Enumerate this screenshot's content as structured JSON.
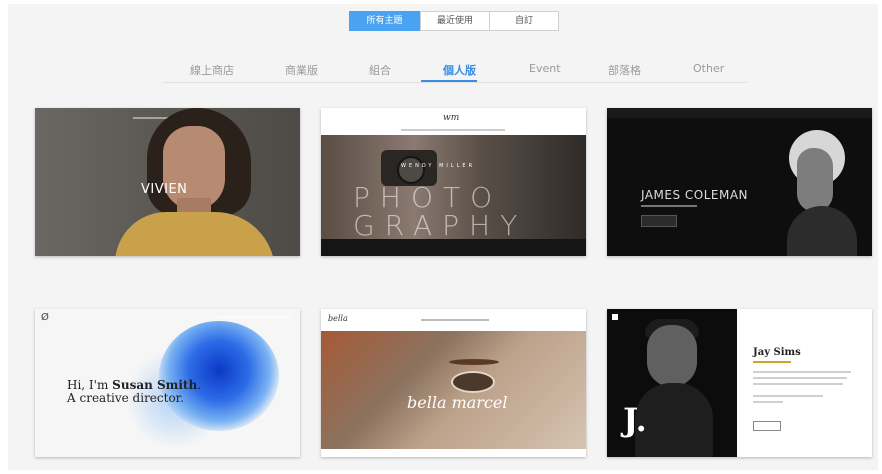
{
  "top_tabs": [
    "所有主題",
    "最近使用",
    "自訂"
  ],
  "category_tabs": [
    "線上商店",
    "商業版",
    "組合",
    "個人版",
    "Event",
    "部落格",
    "Other"
  ],
  "active_category": "個人版",
  "accent_color": "#3a8ee0",
  "templates": [
    {
      "title": "VIVIEN"
    },
    {
      "logo": "wm",
      "name": "WENDY MILLER",
      "big_line1": "PHOTO",
      "big_line2": "GRAPHY"
    },
    {
      "title": "JAMES COLEMAN"
    },
    {
      "logo": "Ø",
      "intro_prefix": "Hi, I'm ",
      "name": "Susan Smith",
      "intro_suffix": ". A creative director."
    },
    {
      "logo": "bella",
      "script": "bella marcel"
    },
    {
      "monogram": "J.",
      "title": "Jay Sims"
    }
  ]
}
